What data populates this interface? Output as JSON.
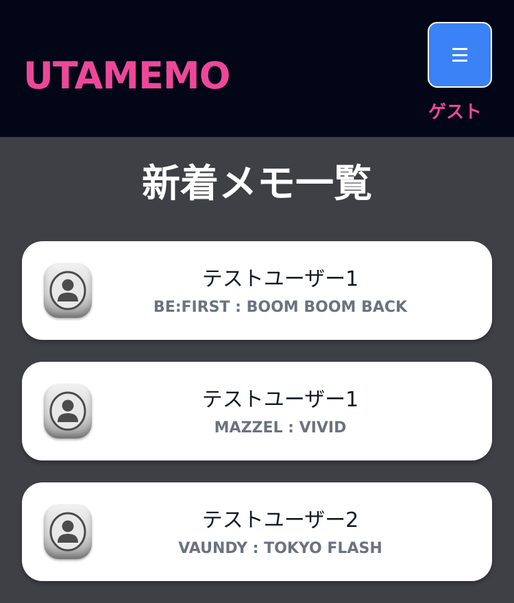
{
  "colors": {
    "header_bg": "#030616",
    "brand": "#ec4899",
    "menu_button_bg": "#3b82f6",
    "page_bg": "#3f3f46",
    "card_bg": "#ffffff"
  },
  "header": {
    "logo": "UTAMEMO",
    "menu_icon": "hamburger-icon",
    "user_name": "ゲスト"
  },
  "main": {
    "title": "新着メモ一覧",
    "memos": [
      {
        "avatar_icon": "user-avatar-icon",
        "user": "テストユーザー1",
        "song": "BE:FIRST : BOOM BOOM BACK"
      },
      {
        "avatar_icon": "user-avatar-icon",
        "user": "テストユーザー1",
        "song": "MAZZEL : VIVID"
      },
      {
        "avatar_icon": "user-avatar-icon",
        "user": "テストユーザー2",
        "song": "VAUNDY : TOKYO FLASH"
      }
    ]
  }
}
